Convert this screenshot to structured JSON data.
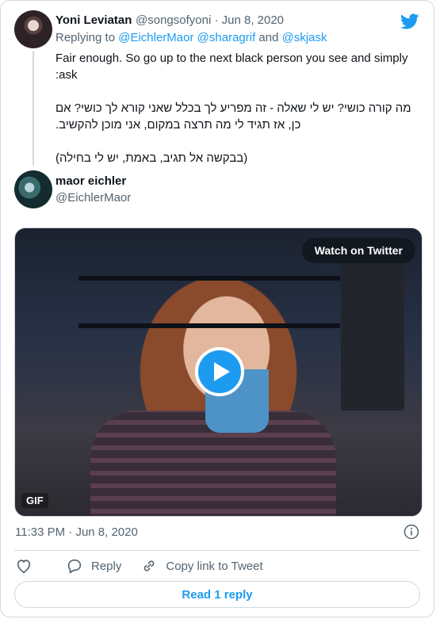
{
  "tweet": {
    "author_name": "Yoni Leviatan",
    "author_handle": "@songsofyoni",
    "date_sep": "·",
    "date": "Jun 8, 2020",
    "replying_prefix": "Replying to ",
    "reply_mentions": [
      "@EichlerMaor",
      "@sharagrif",
      "@skjask"
    ],
    "reply_joiner_1": " ",
    "reply_joiner_2": " and ",
    "text": "Fair enough. So go up to the next black person you see and simply ask:\n\nמה קורה כושי? יש לי שאלה - זה מפריע לך בכלל שאני קורא לך כושי? אם כן, אז תגיד לי מה תרצה במקום, אני מוכן להקשיב.\n\n(בבקשה אל תגיב, באמת, יש לי בחילה)"
  },
  "quoted": {
    "author_name": "maor eichler",
    "author_handle": "@EichlerMaor"
  },
  "media": {
    "watch_label": "Watch on Twitter",
    "gif_label": "GIF"
  },
  "footer": {
    "time": "11:33 PM",
    "sep": "·",
    "date": "Jun 8, 2020"
  },
  "actions": {
    "reply_label": "Reply",
    "copy_label": "Copy link to Tweet"
  },
  "read_replies_label": "Read 1 reply",
  "colors": {
    "accent": "#1d9bf0",
    "muted": "#536471",
    "border": "#cfd9de"
  }
}
